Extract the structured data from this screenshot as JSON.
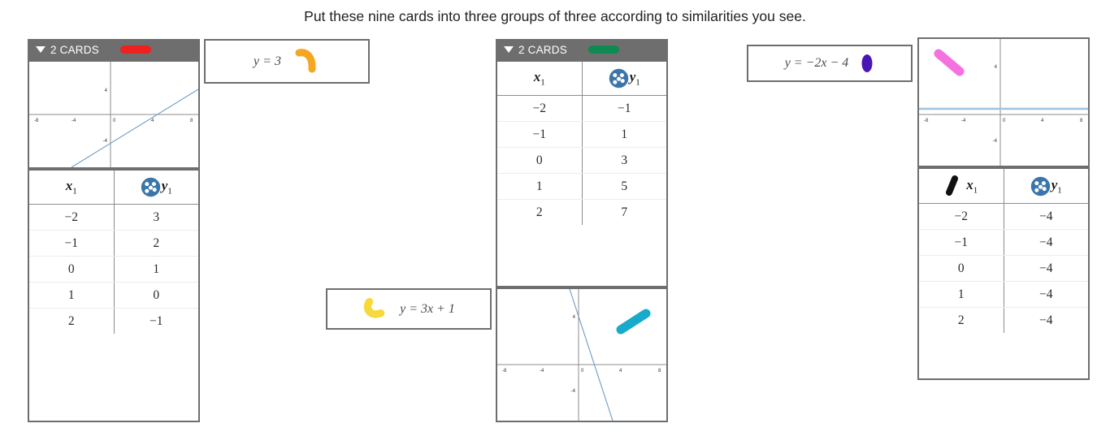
{
  "page": {
    "title": "Put these nine cards into three groups of three according to similarities you see.",
    "background": "#ffffff",
    "header_bg": "#6e6e6e"
  },
  "groups": [
    {
      "id": "group-red",
      "header_label": "2 CARDS",
      "mark_color": "#ef2020",
      "cards": [
        {
          "kind": "graph",
          "graph": {
            "xticks": [
              "-8",
              "-4",
              "0",
              "4",
              "8"
            ],
            "yticks": [
              "4",
              "-4"
            ],
            "line": {
              "slope": 1,
              "intercept": -4,
              "color": "#6f9cc4"
            },
            "mark": null
          }
        },
        {
          "kind": "table",
          "table": {
            "col1": "x",
            "col1_sub": "1",
            "col2": "y",
            "col2_sub": "1",
            "icon": "dice-five-icon",
            "mark": null,
            "rows": [
              [
                "−2",
                "3"
              ],
              [
                "−1",
                "2"
              ],
              [
                "0",
                "1"
              ],
              [
                "1",
                "0"
              ],
              [
                "2",
                "−1"
              ]
            ]
          }
        }
      ]
    },
    {
      "id": "group-green",
      "header_label": "2 CARDS",
      "mark_color": "#0d8a4f",
      "cards": [
        {
          "kind": "table",
          "table": {
            "col1": "x",
            "col1_sub": "1",
            "col2": "y",
            "col2_sub": "1",
            "icon": "dice-five-icon",
            "mark": null,
            "rows": [
              [
                "−2",
                "−1"
              ],
              [
                "−1",
                "1"
              ],
              [
                "0",
                "3"
              ],
              [
                "1",
                "5"
              ],
              [
                "2",
                "7"
              ]
            ]
          }
        },
        {
          "kind": "graph",
          "graph": {
            "xticks": [
              "-8",
              "-4",
              "0",
              "4",
              "8"
            ],
            "yticks": [
              "4",
              "-4"
            ],
            "line": {
              "slope": -4,
              "intercept": 3,
              "color": "#6f9cc4"
            },
            "mark": {
              "color": "#17aacb",
              "style": "diagonal-stroke"
            }
          }
        }
      ]
    },
    {
      "id": "group-ungrouped-right",
      "header_label": null,
      "mark_color": null,
      "cards": [
        {
          "kind": "graph",
          "graph": {
            "xticks": [
              "-8",
              "-4",
              "0",
              "4",
              "8"
            ],
            "yticks": [
              "4",
              "-4"
            ],
            "line": {
              "slope": 0,
              "intercept": 0.9,
              "color": "#9fc3dd"
            },
            "mark": {
              "color": "#f472e0",
              "style": "diagonal-stroke"
            }
          }
        },
        {
          "kind": "table",
          "table": {
            "col1": "x",
            "col1_sub": "1",
            "col2": "y",
            "col2_sub": "1",
            "icon": "dice-five-icon",
            "mark": {
              "color": "#111111",
              "style": "diagonal-stroke"
            },
            "rows": [
              [
                "−2",
                "−4"
              ],
              [
                "−1",
                "−4"
              ],
              [
                "0",
                "−4"
              ],
              [
                "1",
                "−4"
              ],
              [
                "2",
                "−4"
              ]
            ]
          }
        }
      ]
    }
  ],
  "expression_cards": [
    {
      "id": "expr-y-equals-3",
      "text": "y = 3",
      "mark": {
        "color": "#f5a623",
        "style": "curved-stroke",
        "side": "right"
      }
    },
    {
      "id": "expr-y-equals-3x-plus-1",
      "text": "y = 3x + 1",
      "mark": {
        "color": "#f7d93c",
        "style": "curved-stroke",
        "side": "left"
      }
    },
    {
      "id": "expr-y-equals-neg2x-minus-4",
      "text": "y = −2x − 4",
      "mark": {
        "color": "#4b15b5",
        "style": "oval",
        "side": "right"
      }
    }
  ]
}
